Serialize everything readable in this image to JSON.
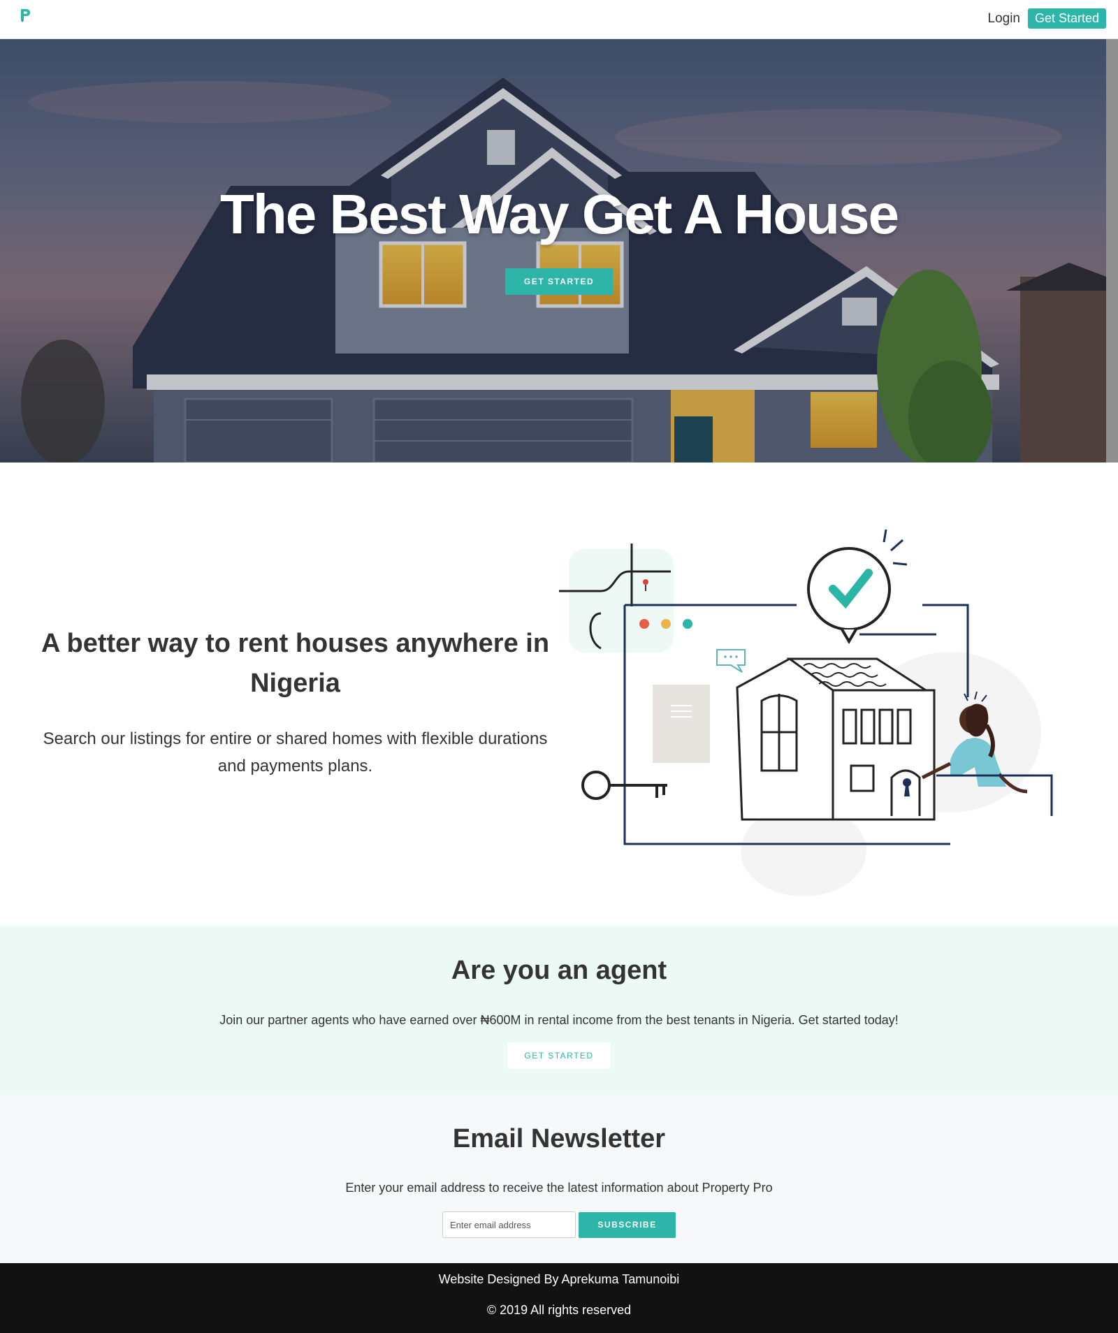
{
  "nav": {
    "logo_icon": "p-logo-icon",
    "login_label": "Login",
    "get_started_label": "Get Started"
  },
  "hero": {
    "title": "The Best Way Get A House",
    "button_label": "GET STARTED"
  },
  "intro": {
    "title": "A better way to rent houses anywhere in Nigeria",
    "subtitle": "Search our listings for entire or shared homes with flexible durations and payments plans."
  },
  "agent": {
    "title": "Are you an agent",
    "text": "Join our partner agents who have earned over ₦600M in rental income from the best tenants in Nigeria. Get started today!",
    "button_label": "GET STARTED"
  },
  "newsletter": {
    "title": "Email Newsletter",
    "text": "Enter your email address to receive the latest information about Property Pro",
    "input_placeholder": "Enter email address",
    "button_label": "SUBSCRIBE"
  },
  "footer": {
    "credit": "Website Designed By Aprekuma Tamunoibi",
    "copyright": "© 2019 All rights reserved"
  },
  "colors": {
    "accent": "#2cb5a8",
    "agent_bg": "#ecf9f5",
    "newsletter_bg": "#f7f8fa",
    "footer_bg": "#121212"
  }
}
